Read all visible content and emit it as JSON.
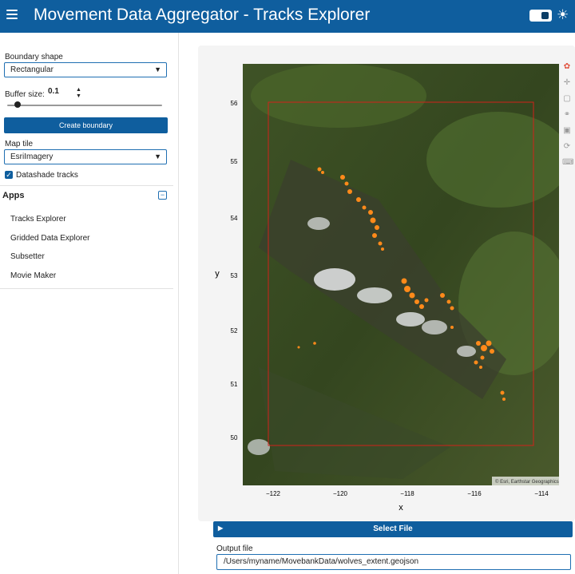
{
  "header": {
    "title": "Movement Data Aggregator  -  Tracks Explorer",
    "menu_icon": "hamburger-icon",
    "theme_icon": "sun-icon"
  },
  "sidebar": {
    "boundary_shape_label": "Boundary shape",
    "boundary_shape_value": "Rectangular",
    "buffer_label": "Buffer size:",
    "buffer_value": "0.1",
    "create_boundary_label": "Create boundary",
    "map_tile_label": "Map tile",
    "map_tile_value": "EsriImagery",
    "datashade_label": "Datashade tracks",
    "datashade_checked": true,
    "apps_title": "Apps",
    "apps": [
      "Tracks Explorer",
      "Gridded Data Explorer",
      "Subsetter",
      "Movie Maker"
    ]
  },
  "plot": {
    "ylabel": "y",
    "xlabel": "x",
    "yticks": [
      "56",
      "55",
      "54",
      "53",
      "52",
      "51",
      "50"
    ],
    "xticks": [
      "−122",
      "−120",
      "−118",
      "−116",
      "−114"
    ],
    "attribution": "© Esri, Earthstar Geographics",
    "toolbar": [
      "bokeh-logo-icon",
      "pan-icon",
      "box-zoom-icon",
      "wheel-zoom-icon",
      "save-icon",
      "reset-icon",
      "hover-icon"
    ]
  },
  "footer": {
    "select_file_label": "Select File",
    "output_label": "Output file",
    "output_value": "/Users/myname/MovebankData/wolves_extent.geojson"
  },
  "colors": {
    "brand": "#0f5e9e",
    "track": "#ff8a1a",
    "boundary": "#d0221a"
  }
}
